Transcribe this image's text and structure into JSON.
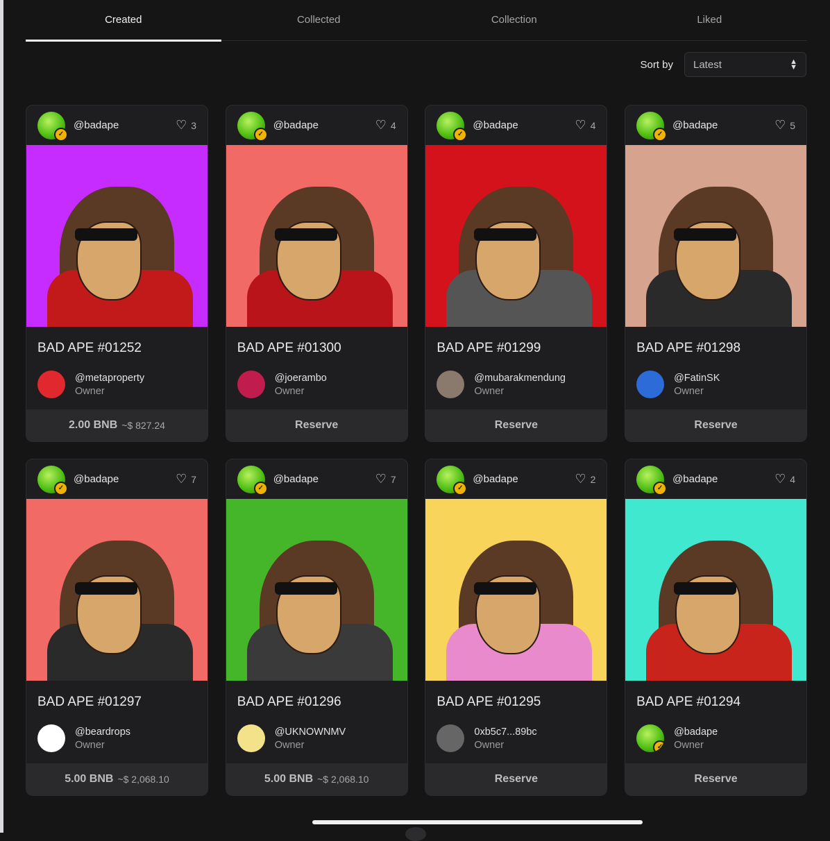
{
  "tabs": [
    {
      "label": "Created",
      "active": true
    },
    {
      "label": "Collected"
    },
    {
      "label": "Collection"
    },
    {
      "label": "Liked"
    }
  ],
  "sort": {
    "label": "Sort by",
    "value": "Latest"
  },
  "owner_role": "Owner",
  "cards": [
    {
      "creator": "@badape",
      "likes": "3",
      "title": "BAD APE #01252",
      "owner": "@metaproperty",
      "price": "2.00 BNB",
      "usd": "~$ 827.24",
      "action": null,
      "bg": "#c62bff",
      "jacket": "#c21a1a"
    },
    {
      "creator": "@badape",
      "likes": "4",
      "title": "BAD APE #01300",
      "owner": "@joerambo",
      "price": null,
      "usd": null,
      "action": "Reserve",
      "bg": "#f26a66",
      "jacket": "#b8141a"
    },
    {
      "creator": "@badape",
      "likes": "4",
      "title": "BAD APE #01299",
      "owner": "@mubarakmendung",
      "price": null,
      "usd": null,
      "action": "Reserve",
      "bg": "#d4121c",
      "jacket": "#555555"
    },
    {
      "creator": "@badape",
      "likes": "5",
      "title": "BAD APE #01298",
      "owner": "@FatinSK",
      "price": null,
      "usd": null,
      "action": "Reserve",
      "bg": "#d6a48e",
      "jacket": "#2a2a2a"
    },
    {
      "creator": "@badape",
      "likes": "7",
      "title": "BAD APE #01297",
      "owner": "@beardrops",
      "price": "5.00 BNB",
      "usd": "~$ 2,068.10",
      "action": null,
      "bg": "#f26a66",
      "jacket": "#2a2a2a"
    },
    {
      "creator": "@badape",
      "likes": "7",
      "title": "BAD APE #01296",
      "owner": "@UKNOWNMV",
      "price": "5.00 BNB",
      "usd": "~$ 2,068.10",
      "action": null,
      "bg": "#45b52a",
      "jacket": "#3a3a3a"
    },
    {
      "creator": "@badape",
      "likes": "2",
      "title": "BAD APE #01295",
      "owner": "0xb5c7...89bc",
      "price": null,
      "usd": null,
      "action": "Reserve",
      "bg": "#f8d55a",
      "jacket": "#e88acb"
    },
    {
      "creator": "@badape",
      "likes": "4",
      "title": "BAD APE #01294",
      "owner": "@badape",
      "price": null,
      "usd": null,
      "action": "Reserve",
      "bg": "#3fe8cf",
      "jacket": "#c8241c"
    }
  ],
  "colors": {
    "background": "#151516",
    "card": "#1e1e20",
    "footer": "#2a2a2c",
    "verified": "#f0b400",
    "avatar_green": "#52c016"
  },
  "icons": {
    "like": "heart-icon",
    "sort": "updown-chevron-icon",
    "verified": "verified-badge-icon"
  }
}
